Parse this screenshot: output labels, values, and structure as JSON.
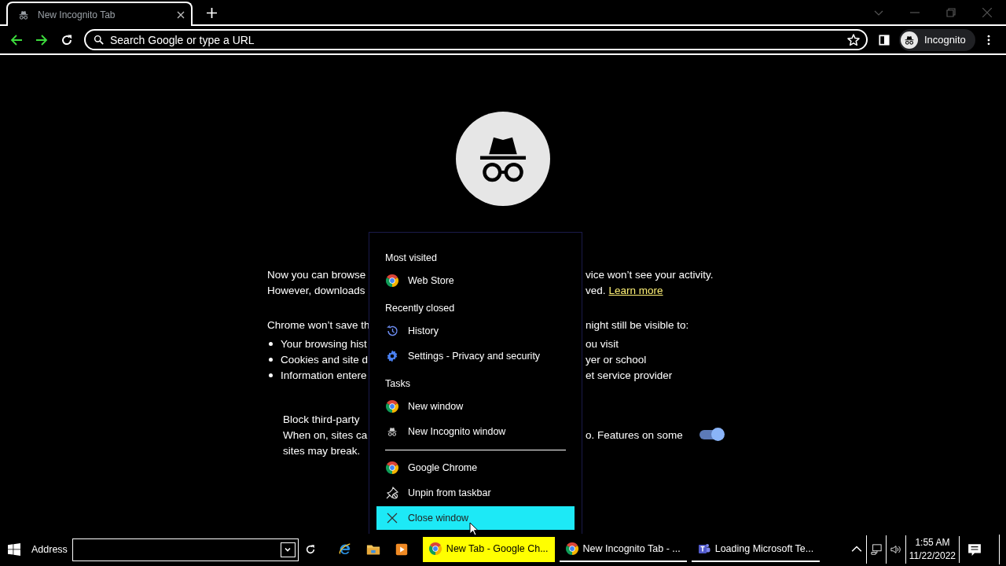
{
  "tab": {
    "title": "New Incognito Tab",
    "selected": true
  },
  "omnibox": {
    "placeholder": "Search Google or type a URL"
  },
  "profile_chip": {
    "label": "Incognito"
  },
  "incognito_page": {
    "intro_lines": [
      {
        "left": "Now you can browse",
        "right": "vice won’t see your activity."
      },
      {
        "left": "However, downloads",
        "right": "ved.",
        "link": "Learn more"
      }
    ],
    "save_line": {
      "left": "Chrome won’t save th",
      "right": "night still be visible to:"
    },
    "bullets": [
      {
        "left": "Your browsing hist",
        "right": "ou visit"
      },
      {
        "left": "Cookies and site d",
        "right": "yer or school"
      },
      {
        "left": "Information entere",
        "right": "et service provider"
      }
    ],
    "cookie_card": {
      "title": "Block third-party",
      "lines": [
        {
          "left": "When on, sites ca",
          "right": "o. Features on some"
        },
        {
          "left": "sites may break."
        }
      ],
      "toggle_on": true
    }
  },
  "jump_list": {
    "items": [
      {
        "kind": "heading",
        "label": "Most visited"
      },
      {
        "kind": "chrome",
        "label": "Web Store",
        "highlighted": false
      },
      {
        "kind": "heading",
        "label": "Recently closed"
      },
      {
        "kind": "history",
        "label": "History",
        "highlighted": false
      },
      {
        "kind": "settings",
        "label": "Settings - Privacy and security",
        "highlighted": false
      },
      {
        "kind": "heading",
        "label": "Tasks"
      },
      {
        "kind": "chrome",
        "label": "New window",
        "highlighted": false
      },
      {
        "kind": "incognito",
        "label": "New Incognito window",
        "highlighted": false
      },
      {
        "kind": "separator"
      },
      {
        "kind": "chrome",
        "label": "Google Chrome",
        "highlighted": false
      },
      {
        "kind": "unpin",
        "label": "Unpin from taskbar",
        "highlighted": false
      },
      {
        "kind": "close",
        "label": "Close window",
        "highlighted": true
      }
    ]
  },
  "taskbar": {
    "address_label": "Address",
    "tasks": [
      {
        "kind": "chrome",
        "label": "New Tab - Google Ch...",
        "selected": true
      },
      {
        "kind": "chrome",
        "label": "New Incognito Tab - ...",
        "selected": false
      },
      {
        "kind": "teams",
        "label": "Loading Microsoft Te...",
        "selected": false
      }
    ],
    "time": "1:55 AM",
    "date": "11/22/2022"
  }
}
